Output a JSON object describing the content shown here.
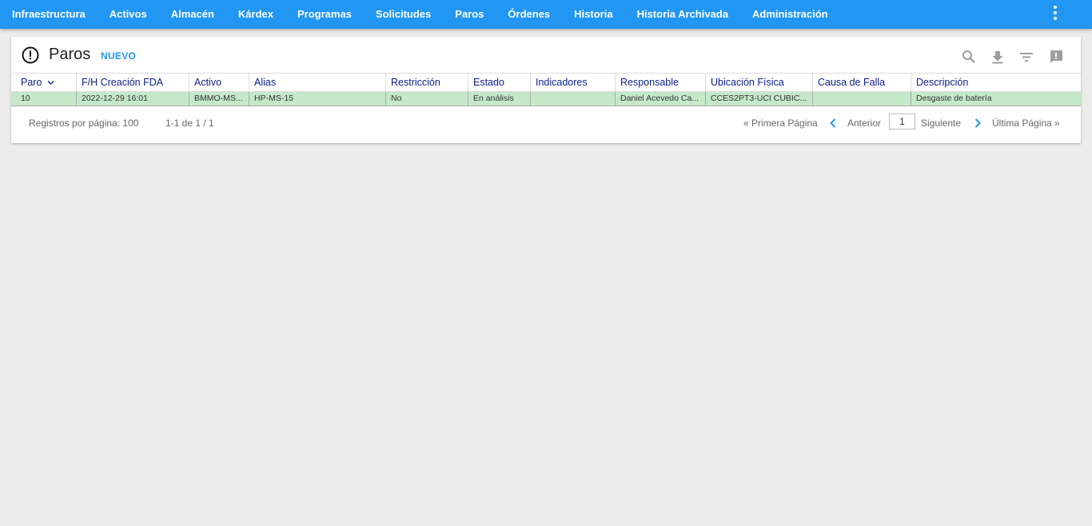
{
  "nav": {
    "items": [
      "Infraestructura",
      "Activos",
      "Almacén",
      "Kárdex",
      "Programas",
      "Solicitudes",
      "Paros",
      "Órdenes",
      "Historia",
      "Historia Archivada",
      "Administración"
    ]
  },
  "header": {
    "title": "Paros",
    "new_label": "NUEVO",
    "icons": [
      "search-icon",
      "download-icon",
      "filter-icon",
      "feedback-icon"
    ]
  },
  "table": {
    "columns": [
      "Paro",
      "F/H Creación FDA",
      "Activo",
      "Alias",
      "Restricción",
      "Estado",
      "Indicadores",
      "Responsable",
      "Ubicación Física",
      "Causa de Falla",
      "Descripción"
    ],
    "rows": [
      [
        "10",
        "2022-12-29 16:01",
        "BMMO-MS...",
        "HP-MS-15",
        "No",
        "En análisis",
        "",
        "Daniel Acevedo Ca...",
        "CCES2PT3-UCI CUBIC...",
        "",
        "Desgaste de batería"
      ]
    ]
  },
  "footer": {
    "per_page": "Registros por página: 100",
    "range": "1-1 de 1 / 1",
    "first": "« Primera Página",
    "prev": "Anterior",
    "page": "1",
    "next": "Siguiente",
    "last": "Última Página »"
  },
  "colors": {
    "nav": "#2196f3",
    "row_highlight": "#c5e9c8",
    "header_text": "#0b1d8c"
  }
}
